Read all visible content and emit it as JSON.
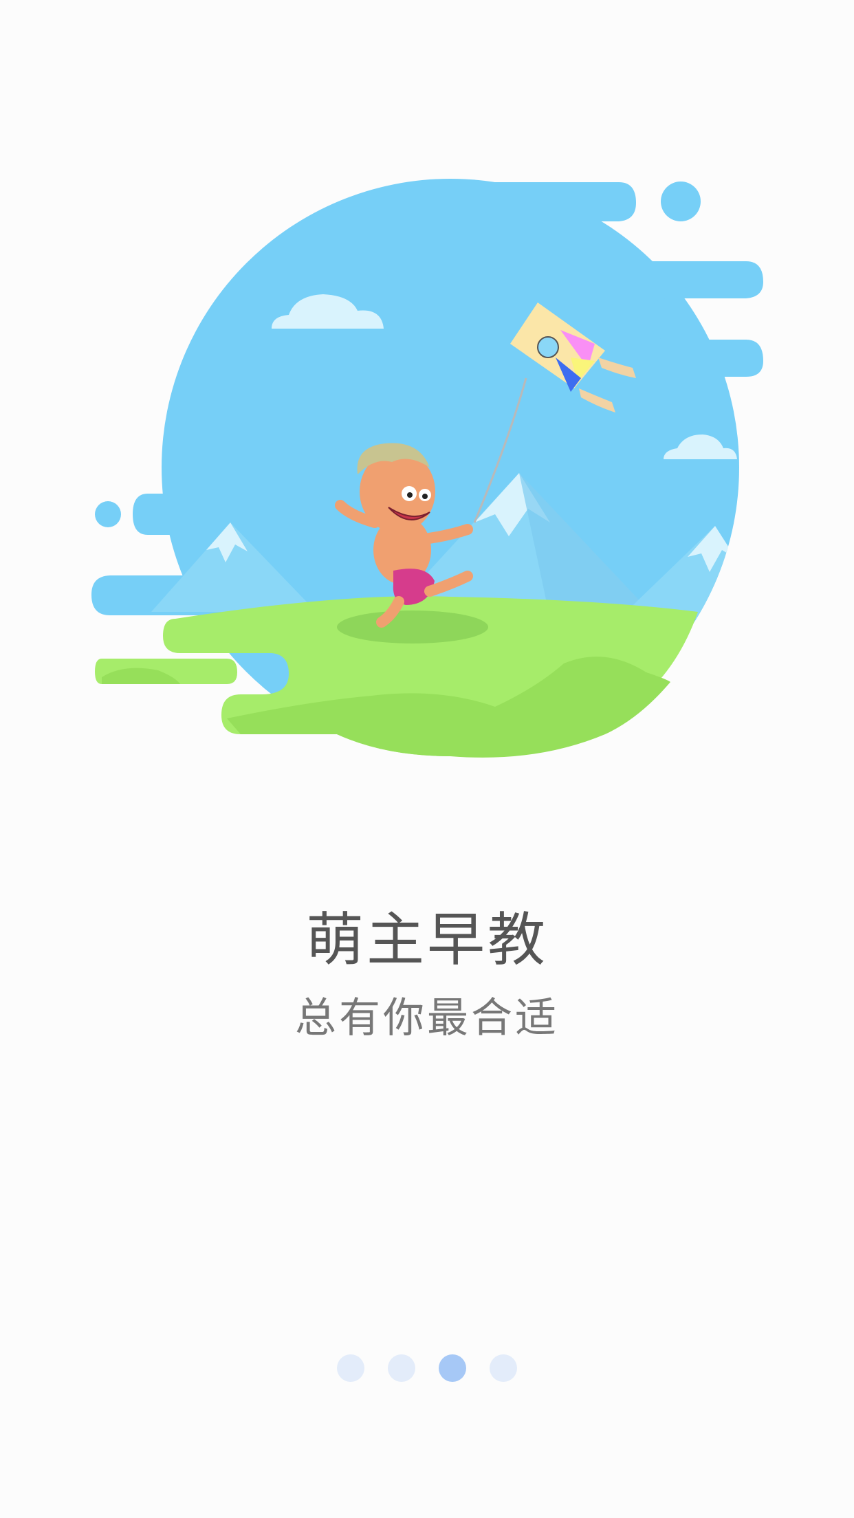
{
  "onboarding": {
    "title": "萌主早教",
    "subtitle": "总有你最合适",
    "illustration": "child-flying-kite",
    "pager": {
      "total": 4,
      "current": 3
    }
  },
  "colors": {
    "sky": "#76cff7",
    "grass": "#a6ec6a",
    "grass_dark": "#96df5a",
    "mountain": "#8ad7f7",
    "cloud": "#d9f3fd",
    "dot_inactive": "#e3ecfa",
    "dot_active": "#a6c8f6",
    "text_title": "#555555",
    "text_subtitle": "#777777"
  }
}
